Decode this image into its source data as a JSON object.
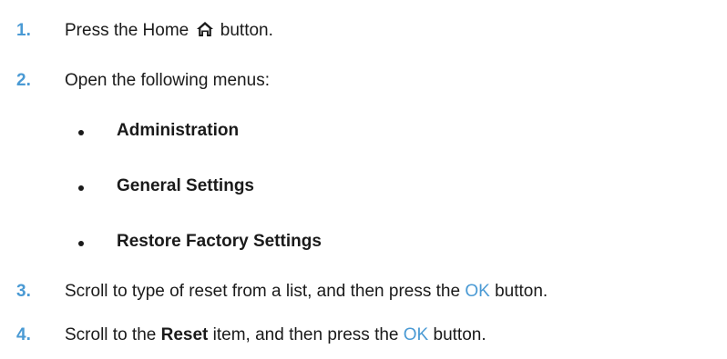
{
  "steps": [
    {
      "number": "1.",
      "text_before": "Press the Home",
      "icon": "home-icon",
      "text_after": "button."
    },
    {
      "number": "2.",
      "text": "Open the following menus:",
      "menus": [
        "Administration",
        "General Settings",
        "Restore Factory Settings"
      ]
    },
    {
      "number": "3.",
      "text_before": "Scroll to type of reset from a list, and then press the",
      "button": "OK",
      "text_after": "button."
    },
    {
      "number": "4.",
      "text_a": "Scroll to the",
      "item": "Reset",
      "text_b": "item, and then press the",
      "button": "OK",
      "text_after": "button."
    }
  ],
  "colors": {
    "accent": "#4a9ad4",
    "text": "#1a1a1a"
  }
}
